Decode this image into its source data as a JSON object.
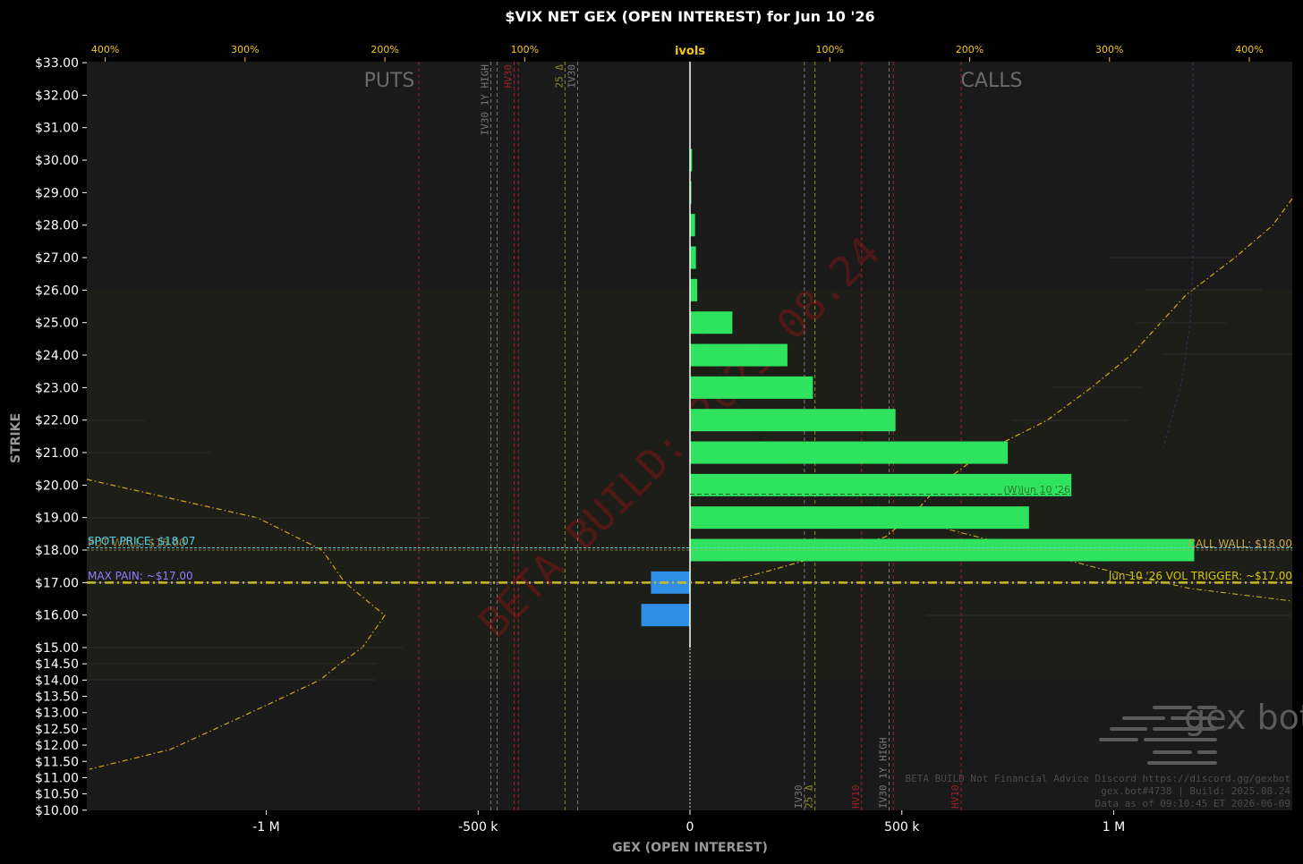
{
  "chart_data": {
    "type": "bar",
    "orientation": "horizontal",
    "title": "$VIX NET GEX (OPEN INTEREST) for Jun 10 '26",
    "xlabel": "GEX (OPEN INTEREST)",
    "ylabel": "STRIKE",
    "xlim": [
      -1420000,
      1420000
    ],
    "x_ticks": [
      {
        "value": -1000000,
        "label": "-1 M"
      },
      {
        "value": -500000,
        "label": "-500 k"
      },
      {
        "value": 0,
        "label": "0"
      },
      {
        "value": 500000,
        "label": "500 k"
      },
      {
        "value": 1000000,
        "label": "1 M"
      }
    ],
    "top_axis_label": "ivols",
    "top_ticks": [
      {
        "value": -1380000,
        "label": "400%"
      },
      {
        "value": -1050000,
        "label": "300%"
      },
      {
        "value": -720000,
        "label": "200%"
      },
      {
        "value": -390000,
        "label": "100%"
      },
      {
        "value": 330000,
        "label": "100%"
      },
      {
        "value": 660000,
        "label": "200%"
      },
      {
        "value": 990000,
        "label": "300%"
      },
      {
        "value": 1320000,
        "label": "400%"
      }
    ],
    "y_ticks": [
      "$33.00",
      "$32.00",
      "$31.00",
      "$30.00",
      "$29.00",
      "$28.00",
      "$27.00",
      "$26.00",
      "$25.00",
      "$24.00",
      "$23.00",
      "$22.00",
      "$21.00",
      "$20.00",
      "$19.00",
      "$18.00",
      "$17.00",
      "$16.00",
      "$15.00",
      "$14.50",
      "$14.00",
      "$13.50",
      "$13.00",
      "$12.50",
      "$12.00",
      "$11.50",
      "$11.00",
      "$10.50",
      "$10.00"
    ],
    "side_labels": {
      "puts": "PUTS",
      "calls": "CALLS"
    },
    "series": [
      {
        "color": "#2fe35f",
        "points": [
          {
            "strike": 30,
            "value": 5000
          },
          {
            "strike": 29,
            "value": 2000
          },
          {
            "strike": 28,
            "value": 12000
          },
          {
            "strike": 27,
            "value": 14000
          },
          {
            "strike": 26,
            "value": 17000
          },
          {
            "strike": 25,
            "value": 100000
          },
          {
            "strike": 24,
            "value": 230000
          },
          {
            "strike": 23,
            "value": 290000
          },
          {
            "strike": 22,
            "value": 485000
          },
          {
            "strike": 21,
            "value": 750000
          },
          {
            "strike": 20,
            "value": 900000
          },
          {
            "strike": 19,
            "value": 800000
          },
          {
            "strike": 18,
            "value": 1190000
          }
        ]
      },
      {
        "color": "#2f8fe6",
        "points": [
          {
            "strike": 17,
            "value": -92000
          },
          {
            "strike": 16,
            "value": -115000
          }
        ]
      }
    ],
    "hlines": [
      {
        "strike": 18.07,
        "label": "SPOT PRICE: $18.07",
        "color": "#4fd1e8"
      },
      {
        "strike": 18.0,
        "label": "CALL WALL: $18.00",
        "color": "#c8a84a"
      },
      {
        "strike": 17.0,
        "label": "MAX PAIN: ~$17.00",
        "color": "#8d7dff"
      },
      {
        "strike": 17.0,
        "label": "Jun 10 '26 VOL TRIGGER: ~$17.00",
        "color": "#d4c800"
      }
    ],
    "overlapping_text": "PUT WALL: $18.00",
    "expiry_line_label": "(W)Jun 10 '26",
    "vlines": [
      {
        "x": -640000,
        "label": "",
        "color": "#9b2020"
      },
      {
        "x": -470000,
        "label": "IV30 1Y HIGH",
        "color": "#777777"
      },
      {
        "x": -455000,
        "label": "",
        "color": "#777777"
      },
      {
        "x": -415000,
        "label": "HV30",
        "color": "#9b2020"
      },
      {
        "x": -405000,
        "label": "",
        "color": "#9b2020"
      },
      {
        "x": -265000,
        "label": "IV30",
        "color": "#777777"
      },
      {
        "x": -295000,
        "label": "25 Δ",
        "color": "#8b8b2a"
      },
      {
        "x": 270000,
        "label": "IV30",
        "color": "#777777"
      },
      {
        "x": 295000,
        "label": "25 Δ",
        "color": "#8b8b2a"
      },
      {
        "x": 405000,
        "label": "HV10",
        "color": "#9b2020"
      },
      {
        "x": 470000,
        "label": "IV30 1Y HIGH",
        "color": "#777777"
      },
      {
        "x": 480000,
        "label": "",
        "color": "#9b2020"
      },
      {
        "x": 640000,
        "label": "HV10",
        "color": "#9b2020"
      }
    ],
    "grid": false,
    "watermark": "BETA BUILD: 2025.08.24",
    "logo": "gex bot",
    "footer_lines": [
      "BETA BUILD Not Financial Advice Discord https://discord.gg/gexbot",
      "gex.bot#4738 | Build: 2025.08.24",
      "Data as of 09:10:45 ET 2026-06-09"
    ]
  }
}
